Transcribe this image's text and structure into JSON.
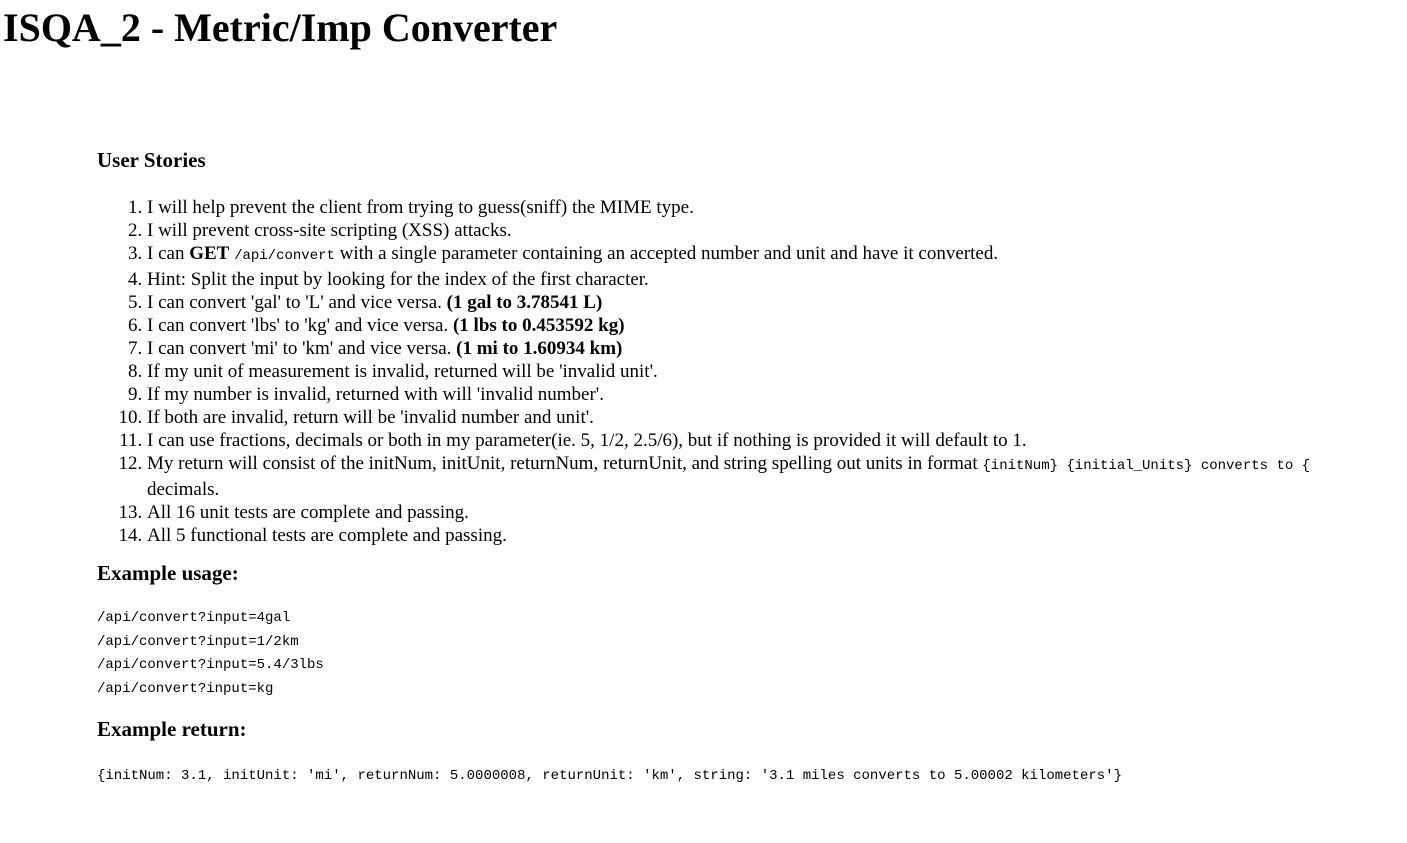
{
  "title": "ISQA_2 - Metric/Imp Converter",
  "user_stories_heading": "User Stories",
  "stories": [
    {
      "text": "I will help prevent the client from trying to guess(sniff) the MIME type."
    },
    {
      "text": "I will prevent cross-site scripting (XSS) attacks."
    },
    {
      "pre": "I can ",
      "bold": "GET",
      "code": "/api/convert",
      "post": " with a single parameter containing an accepted number and unit and have it converted."
    },
    {
      "text": "Hint: Split the input by looking for the index of the first character."
    },
    {
      "pre": "I can convert 'gal' to 'L' and vice versa. ",
      "bold": "(1 gal to 3.78541 L)"
    },
    {
      "pre": "I can convert 'lbs' to 'kg' and vice versa. ",
      "bold": "(1 lbs to 0.453592 kg)"
    },
    {
      "pre": "I can convert 'mi' to 'km' and vice versa. ",
      "bold": "(1 mi to 1.60934 km)"
    },
    {
      "text": "If my unit of measurement is invalid, returned will be 'invalid unit'."
    },
    {
      "text": "If my number is invalid, returned with will 'invalid number'."
    },
    {
      "text": "If both are invalid, return will be 'invalid number and unit'."
    },
    {
      "text": "I can use fractions, decimals or both in my parameter(ie. 5, 1/2, 2.5/6), but if nothing is provided it will default to 1."
    },
    {
      "pre": "My return will consist of the initNum, initUnit, returnNum, returnUnit, and string spelling out units in format ",
      "code": "{initNum} {initial_Units} converts to {",
      "post": "decimals."
    },
    {
      "text": "All 16 unit tests are complete and passing."
    },
    {
      "text": "All 5 functional tests are complete and passing."
    }
  ],
  "example_usage_heading": "Example usage:",
  "example_usage": [
    "/api/convert?input=4gal",
    "/api/convert?input=1/2km",
    "/api/convert?input=5.4/3lbs",
    "/api/convert?input=kg"
  ],
  "example_return_heading": "Example return:",
  "example_return": "{initNum: 3.1, initUnit: 'mi', returnNum: 5.0000008, returnUnit: 'km', string: '3.1 miles converts to 5.00002 kilometers'}"
}
